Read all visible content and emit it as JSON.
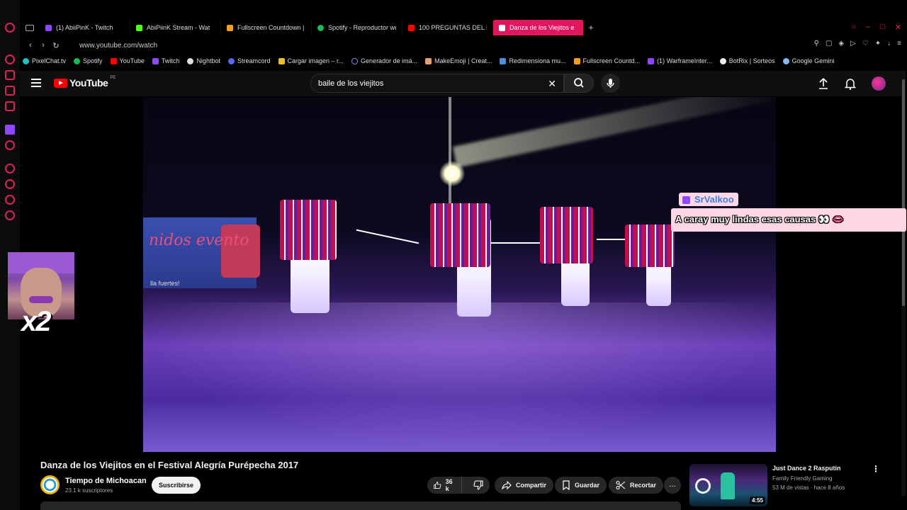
{
  "browser": {
    "tabs": [
      {
        "label": "(1) AbiiPinK - Twitch",
        "color": "#9146ff"
      },
      {
        "label": "AbiPiinK Stream - Wat",
        "color": "#53fc18"
      },
      {
        "label": "Fullscreen Countdown | T",
        "color": "#f0a020"
      },
      {
        "label": "Spotify - Reproductor we",
        "color": "#1db954"
      },
      {
        "label": "100 PREGUNTAS DEL PER",
        "color": "#ff0000"
      },
      {
        "label": "Danza de los Viejitos e",
        "color": "#ff0000",
        "active": true
      }
    ],
    "url": "www.youtube.com/watch",
    "accent": "#e0165f",
    "bookmarks": [
      {
        "label": "PixelChat.tv",
        "color": "#20c0c0"
      },
      {
        "label": "Spotify",
        "color": "#1db954"
      },
      {
        "label": "YouTube",
        "color": "#ff0000"
      },
      {
        "label": "Twitch",
        "color": "#9146ff"
      },
      {
        "label": "Nightbot",
        "color": "#dddddd"
      },
      {
        "label": "Streamcord",
        "color": "#5865f2"
      },
      {
        "label": "Cargar imagen – r...",
        "color": "#f0c020"
      },
      {
        "label": "Generador de imá...",
        "color": "#8888ff"
      },
      {
        "label": "MakeEmoji | Creat...",
        "color": "#e0a070"
      },
      {
        "label": "Redimensiona mu...",
        "color": "#4a90e2"
      },
      {
        "label": "Fullscreen Countd...",
        "color": "#f0a020"
      },
      {
        "label": "(1) WarframeInter...",
        "color": "#9146ff"
      },
      {
        "label": "BotRix | Sorteos",
        "color": "#eeeeee"
      },
      {
        "label": "Google Gemini",
        "color": "#8ab4f8"
      }
    ]
  },
  "youtube": {
    "logo_text": "YouTube",
    "region": "PE",
    "search_value": "baile de los viejitos"
  },
  "overlay": {
    "cam_label": "x2",
    "chat_user": "SrValkoo",
    "chat_message": "A caray muy lindas esas causas 👀 👄"
  },
  "video": {
    "title": "Danza de los Viejitos en el Festival Alegría Purépecha 2017",
    "banner_text": "nidos   evento",
    "banner_sub": "lla fuertes!",
    "channel": "Tiempo de Michoacan",
    "subscribers": "23.1 k suscriptores",
    "subscribe_label": "Suscribirse",
    "likes": "36 k",
    "share_label": "Compartir",
    "save_label": "Guardar",
    "clip_label": "Recortar",
    "more_label": "..."
  },
  "recommendation": {
    "title": "Just Dance 2 Rasputin",
    "channel": "Family Friendly Gaming",
    "meta": "53 M de vistas · hace 8 años",
    "duration": "4:55"
  }
}
